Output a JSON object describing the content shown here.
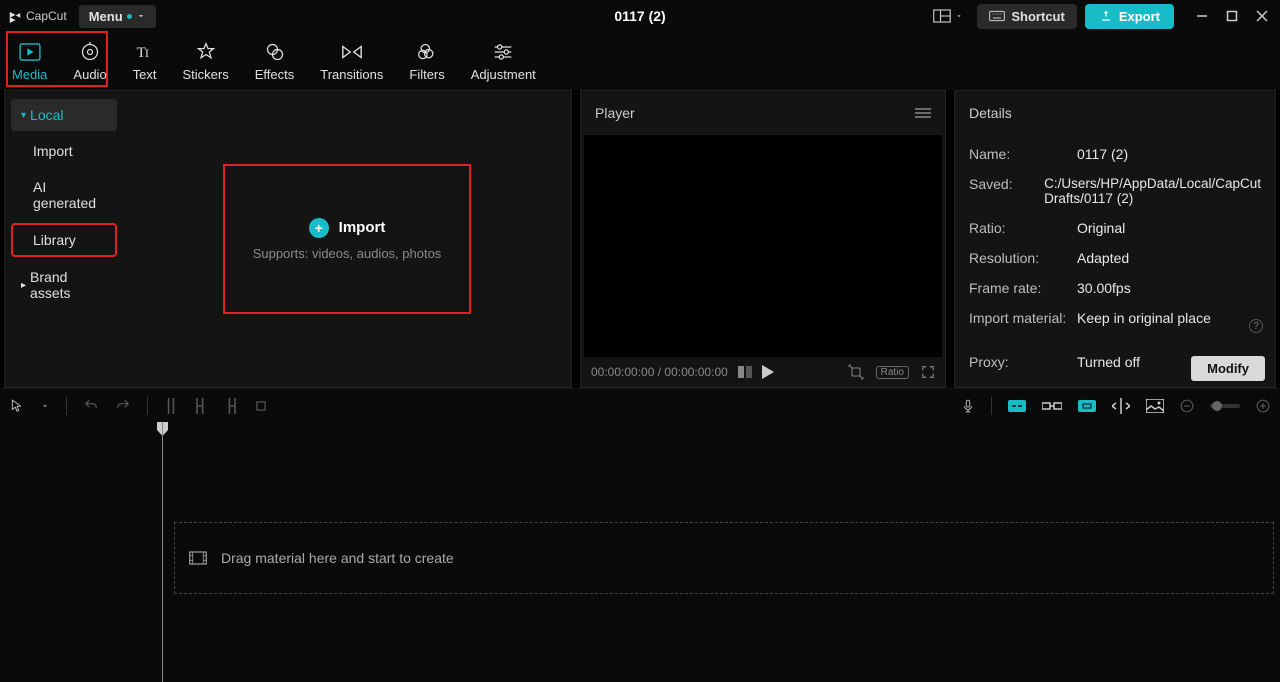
{
  "titlebar": {
    "logo_text": "CapCut",
    "menu_label": "Menu",
    "project_title": "0117 (2)",
    "shortcut_label": "Shortcut",
    "export_label": "Export"
  },
  "tooltabs": {
    "media": "Media",
    "audio": "Audio",
    "text": "Text",
    "stickers": "Stickers",
    "effects": "Effects",
    "transitions": "Transitions",
    "filters": "Filters",
    "adjustment": "Adjustment"
  },
  "sidebar": {
    "local": "Local",
    "import": "Import",
    "ai_generated": "AI generated",
    "library": "Library",
    "brand_assets": "Brand assets"
  },
  "import_box": {
    "title": "Import",
    "subtitle": "Supports: videos, audios, photos"
  },
  "player": {
    "header": "Player",
    "time": "00:00:00:00 / 00:00:00:00",
    "ratio_label": "Ratio"
  },
  "details": {
    "header": "Details",
    "rows": {
      "name_label": "Name:",
      "name_value": "0117 (2)",
      "saved_label": "Saved:",
      "saved_value": "C:/Users/HP/AppData/Local/CapCut Drafts/0117 (2)",
      "ratio_label": "Ratio:",
      "ratio_value": "Original",
      "resolution_label": "Resolution:",
      "resolution_value": "Adapted",
      "framerate_label": "Frame rate:",
      "framerate_value": "30.00fps",
      "import_label": "Import material:",
      "import_value": "Keep in original place",
      "proxy_label": "Proxy:",
      "proxy_value": "Turned off"
    },
    "modify_label": "Modify"
  },
  "timeline": {
    "drop_hint": "Drag material here and start to create"
  }
}
